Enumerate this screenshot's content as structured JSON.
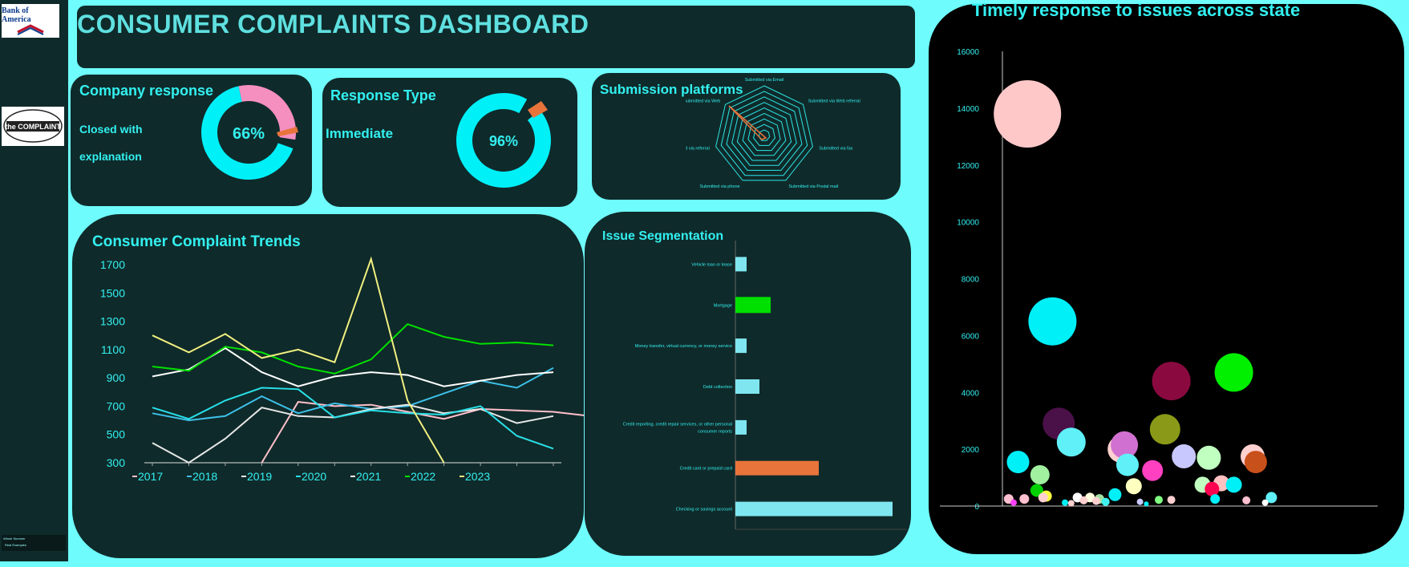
{
  "sidebar": {
    "bank_logo": "Bank of America",
    "complaint_logo": "the COMPLAINT",
    "mini_legend": [
      "Whole Summer",
      "Real Examples"
    ]
  },
  "header": {
    "title": "CONSUMER COMPLAINTS DASHBOARD"
  },
  "company_response": {
    "title": "Company response",
    "label_line1": "Closed with",
    "label_line2": "explanation",
    "percent": "66%",
    "value": 66,
    "colors": [
      "#00f0f8",
      "#f48fc0",
      "#e8743b"
    ]
  },
  "response_type": {
    "title": "Response Type",
    "label": "Immediate",
    "percent": "96%",
    "value": 96,
    "colors": [
      "#00f0f8",
      "#e8743b"
    ]
  },
  "submission": {
    "title": "Submission platforms",
    "axes": [
      "Submitted via Email",
      "Submitted via Web referral",
      "Submitted via fax",
      "Submitted via Postal mail",
      "Submitted via phone",
      "Submitted via referral",
      "Submitted via Web"
    ]
  },
  "trends": {
    "title": "Consumer Complaint Trends",
    "chart_data": {
      "type": "line",
      "ylim": [
        300,
        1700
      ],
      "yticks": [
        "1700",
        "1500",
        "1300",
        "1100",
        "900",
        "700",
        "500",
        "300"
      ],
      "legend": [
        "2017",
        "2018",
        "2019",
        "2020",
        "2021",
        "2022",
        "2023"
      ],
      "series": [
        {
          "name": "2017",
          "color": "#ffc0cb",
          "values": [
            null,
            null,
            null,
            200,
            730,
            700,
            710,
            660,
            610,
            680,
            670,
            660,
            630
          ]
        },
        {
          "name": "2018",
          "color": "#3cc0e8",
          "values": [
            650,
            600,
            630,
            770,
            650,
            720,
            680,
            700,
            790,
            880,
            830,
            970
          ]
        },
        {
          "name": "2019",
          "color": "#e8e8e8",
          "values": [
            440,
            290,
            470,
            690,
            630,
            620,
            680,
            710,
            650,
            680,
            580,
            630
          ]
        },
        {
          "name": "2020",
          "color": "#28e0e8",
          "values": [
            690,
            610,
            740,
            830,
            820,
            620,
            670,
            650,
            640,
            700,
            490,
            400
          ]
        },
        {
          "name": "2021",
          "color": "#ffffff",
          "values": [
            910,
            960,
            1110,
            940,
            840,
            910,
            940,
            920,
            840,
            880,
            920,
            940
          ]
        },
        {
          "name": "2022",
          "color": "#00e000",
          "values": [
            980,
            950,
            1120,
            1080,
            980,
            930,
            1030,
            1280,
            1190,
            1140,
            1150,
            1130
          ]
        },
        {
          "name": "2023",
          "color": "#f0f080",
          "values": [
            1200,
            1080,
            1210,
            1040,
            1100,
            1010,
            1740,
            740,
            210,
            null,
            null,
            null
          ]
        }
      ]
    }
  },
  "issues": {
    "title": "Issue Segmentation",
    "chart_data": {
      "type": "bar",
      "categories": [
        "Vehicle loan or lease",
        "Mortgage",
        "Money transfer, virtual currency, or money service",
        "Debt collection",
        "Credit reporting, credit repair services, or other personal consumer reports",
        "Credit card or prepaid card",
        "Checking or savings account"
      ],
      "values": [
        70,
        220,
        70,
        150,
        70,
        520,
        980
      ],
      "colors": [
        "#7fe6f0",
        "#00e000",
        "#7fe6f0",
        "#7fe6f0",
        "#7fe6f0",
        "#e8743b",
        "#7fe6f0"
      ],
      "xlim": [
        0,
        1000
      ]
    }
  },
  "timely": {
    "title": "Timely response to issues across state",
    "chart_data": {
      "type": "scatter",
      "ylim": [
        0,
        16000
      ],
      "yticks": [
        "16000",
        "14000",
        "12000",
        "10000",
        "8000",
        "6000",
        "4000",
        "2000",
        "0"
      ],
      "xlim": [
        0,
        60
      ],
      "points": [
        {
          "x": 4,
          "y": 13800,
          "r": 42,
          "c": "#ffc8c8"
        },
        {
          "x": 8,
          "y": 6500,
          "r": 30,
          "c": "#00f0f8"
        },
        {
          "x": 27,
          "y": 4400,
          "r": 24,
          "c": "#8a0a40"
        },
        {
          "x": 37,
          "y": 4700,
          "r": 24,
          "c": "#00f000"
        },
        {
          "x": 9,
          "y": 2900,
          "r": 20,
          "c": "#4a1048"
        },
        {
          "x": 11,
          "y": 2250,
          "r": 18,
          "c": "#5ff0f8"
        },
        {
          "x": 26,
          "y": 2700,
          "r": 19,
          "c": "#8a9a18"
        },
        {
          "x": 19,
          "y": 2000,
          "r": 17,
          "c": "#ffd0d0"
        },
        {
          "x": 19.5,
          "y": 2150,
          "r": 17,
          "c": "#d070d0"
        },
        {
          "x": 2.5,
          "y": 1550,
          "r": 14,
          "c": "#00f0f8"
        },
        {
          "x": 20,
          "y": 1450,
          "r": 14,
          "c": "#5ff0f8"
        },
        {
          "x": 29,
          "y": 1750,
          "r": 15,
          "c": "#c8c8ff"
        },
        {
          "x": 33,
          "y": 1700,
          "r": 15,
          "c": "#c0ffc0"
        },
        {
          "x": 40,
          "y": 1750,
          "r": 15,
          "c": "#ffd0d0"
        },
        {
          "x": 40.5,
          "y": 1550,
          "r": 14,
          "c": "#c8501a"
        },
        {
          "x": 6,
          "y": 1100,
          "r": 12,
          "c": "#a0f0a0"
        },
        {
          "x": 24,
          "y": 1250,
          "r": 13,
          "c": "#ff40c0"
        },
        {
          "x": 21,
          "y": 700,
          "r": 10,
          "c": "#ffffc0"
        },
        {
          "x": 32,
          "y": 750,
          "r": 10,
          "c": "#c0ffc0"
        },
        {
          "x": 35,
          "y": 800,
          "r": 10,
          "c": "#ffc0c0"
        },
        {
          "x": 37,
          "y": 750,
          "r": 10,
          "c": "#00f0f8"
        },
        {
          "x": 33.5,
          "y": 600,
          "r": 9,
          "c": "#ff0050"
        },
        {
          "x": 5.5,
          "y": 550,
          "r": 8,
          "c": "#00d000"
        },
        {
          "x": 7,
          "y": 350,
          "r": 7,
          "c": "#ffff40"
        },
        {
          "x": 6.5,
          "y": 300,
          "r": 6,
          "c": "#ffd0d0"
        },
        {
          "x": 3.5,
          "y": 250,
          "r": 6,
          "c": "#ffc0d0"
        },
        {
          "x": 1,
          "y": 250,
          "r": 6,
          "c": "#ffc0d0"
        },
        {
          "x": 1.8,
          "y": 120,
          "r": 4,
          "c": "#ff40ff"
        },
        {
          "x": 18,
          "y": 400,
          "r": 8,
          "c": "#00f0f8"
        },
        {
          "x": 12,
          "y": 300,
          "r": 6,
          "c": "#ffffff"
        },
        {
          "x": 14,
          "y": 300,
          "r": 6,
          "c": "#ffffe0"
        },
        {
          "x": 15.5,
          "y": 250,
          "r": 6,
          "c": "#a0e0a0"
        },
        {
          "x": 13,
          "y": 200,
          "r": 5,
          "c": "#ffd0d0"
        },
        {
          "x": 15,
          "y": 180,
          "r": 5,
          "c": "#ffd0d0"
        },
        {
          "x": 16.5,
          "y": 150,
          "r": 5,
          "c": "#40f0f0"
        },
        {
          "x": 10,
          "y": 120,
          "r": 4,
          "c": "#00f0f8"
        },
        {
          "x": 11,
          "y": 100,
          "r": 4,
          "c": "#ffd0d0"
        },
        {
          "x": 22,
          "y": 150,
          "r": 4,
          "c": "#c8c8ff"
        },
        {
          "x": 23,
          "y": 80,
          "r": 3,
          "c": "#00f0f8"
        },
        {
          "x": 25,
          "y": 220,
          "r": 5,
          "c": "#80ff80"
        },
        {
          "x": 27,
          "y": 220,
          "r": 5,
          "c": "#ffd0d0"
        },
        {
          "x": 34,
          "y": 250,
          "r": 6,
          "c": "#00f0f8"
        },
        {
          "x": 43,
          "y": 300,
          "r": 7,
          "c": "#5ff0f8"
        },
        {
          "x": 39,
          "y": 200,
          "r": 5,
          "c": "#ffc0d0"
        },
        {
          "x": 42,
          "y": 120,
          "r": 4,
          "c": "#ffffff"
        }
      ]
    }
  }
}
